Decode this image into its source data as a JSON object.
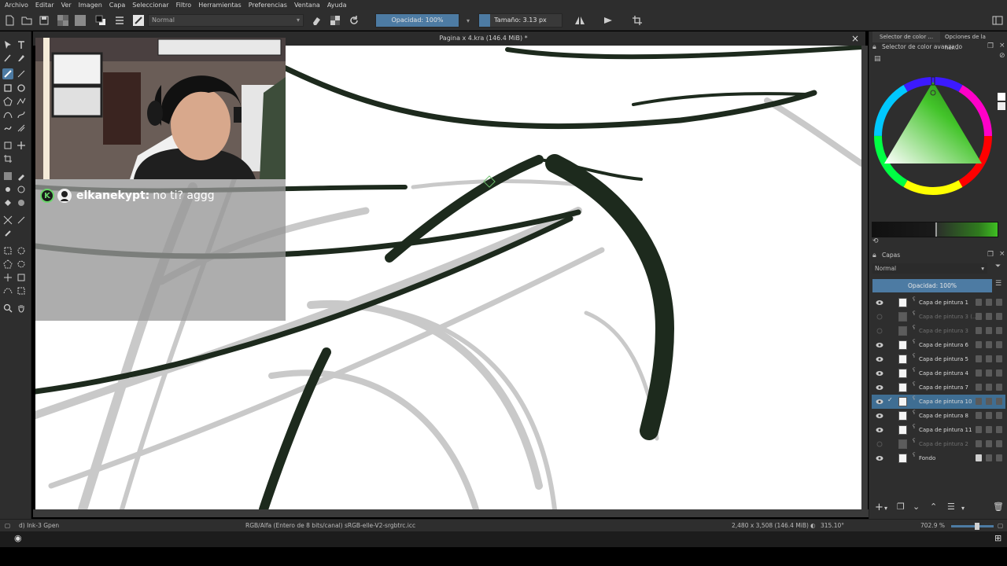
{
  "menu": [
    "Archivo",
    "Editar",
    "Ver",
    "Imagen",
    "Capa",
    "Seleccionar",
    "Filtro",
    "Herramientas",
    "Preferencias",
    "Ventana",
    "Ayuda"
  ],
  "toolbar": {
    "blend_mode": "Normal",
    "opacity_label": "Opacidad: 100%",
    "size_label": "Tamaño: 3.13 px"
  },
  "document": {
    "title": "Pagina x 4.kra (146.4 MiB) *"
  },
  "chat": {
    "username": "elkanekypt:",
    "message": "no ti? aggg"
  },
  "docker": {
    "tab1": "Selector de color ...",
    "tab2": "Opciones de la her...",
    "color_selector_title": "Selector de color avanzado",
    "layers_title": "Capas",
    "layers_blend": "Normal",
    "layers_opacity": "Opacidad:  100%"
  },
  "layers": [
    {
      "name": "Capa de pintura 1",
      "visible": true,
      "thumb": "white",
      "selected": false
    },
    {
      "name": "Capa de pintura 3 (...",
      "visible": false,
      "thumb": "dim",
      "selected": false
    },
    {
      "name": "Capa de pintura 3",
      "visible": false,
      "thumb": "dim",
      "selected": false
    },
    {
      "name": "Capa de pintura 6",
      "visible": true,
      "thumb": "white",
      "selected": false
    },
    {
      "name": "Capa de pintura 5",
      "visible": true,
      "thumb": "white",
      "selected": false
    },
    {
      "name": "Capa de pintura 4",
      "visible": true,
      "thumb": "white",
      "selected": false
    },
    {
      "name": "Capa de pintura 7",
      "visible": true,
      "thumb": "white",
      "selected": false
    },
    {
      "name": "Capa de pintura 10",
      "visible": true,
      "thumb": "white",
      "selected": true
    },
    {
      "name": "Capa de pintura 8",
      "visible": true,
      "thumb": "white",
      "selected": false
    },
    {
      "name": "Capa de pintura 11",
      "visible": true,
      "thumb": "white",
      "selected": false
    },
    {
      "name": "Capa de pintura 2",
      "visible": false,
      "thumb": "dim",
      "selected": false
    },
    {
      "name": "Fondo",
      "visible": true,
      "thumb": "white",
      "selected": false
    }
  ],
  "status": {
    "brush": "d) Ink-3 Gpen",
    "color_space": "RGB/Alfa (Entero de 8 bits/canal)  sRGB-elle-V2-srgbtrc.icc",
    "dimensions": "2,480 x 3,508 (146.4 MiB)",
    "rotation": "315.10°",
    "zoom": "702.9 %"
  },
  "colors": {
    "accent": "#4d7ba3",
    "panel": "#2e2e2e",
    "ink": "#1e2a1e",
    "sketch": "#c8c8c8",
    "selected_color": "#2f7a1e"
  }
}
